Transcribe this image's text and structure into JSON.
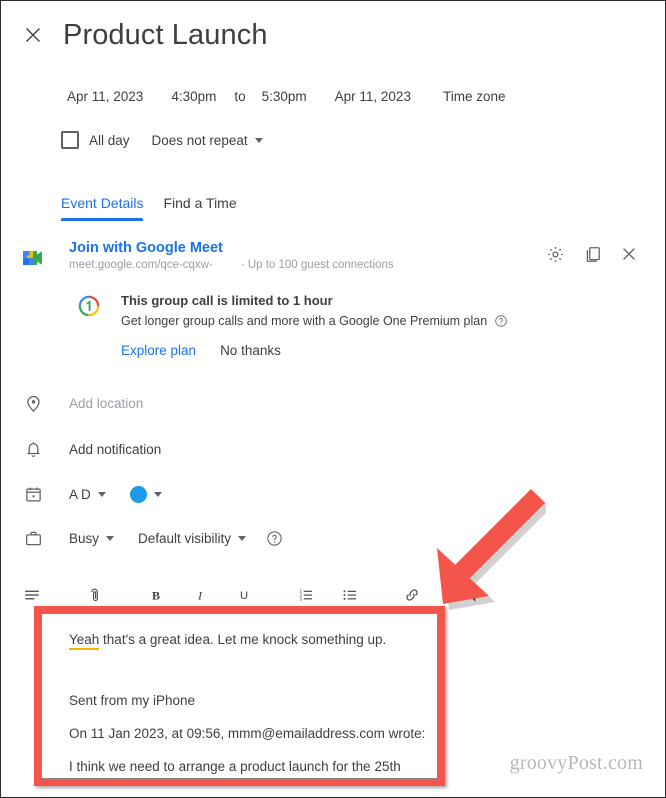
{
  "window": {
    "close_icon": "close-icon",
    "title": "Product Launch"
  },
  "schedule": {
    "start_date": "Apr 11, 2023",
    "start_time": "4:30pm",
    "to_label": "to",
    "end_time": "5:30pm",
    "end_date": "Apr 11, 2023",
    "timezone_label": "Time zone",
    "all_day_label": "All day",
    "repeat_label": "Does not repeat"
  },
  "tabs": [
    {
      "label": "Event Details",
      "active": true
    },
    {
      "label": "Find a Time",
      "active": false
    }
  ],
  "meet": {
    "icon": "google-meet-icon",
    "join_label": "Join with Google Meet",
    "url": "meet.google.com/qce-cqxw-",
    "guest_limit": "· Up to 100 guest connections",
    "settings_icon": "gear-icon",
    "copy_icon": "copy-icon",
    "remove_icon": "close-icon"
  },
  "google_one": {
    "badge_icon": "google-one-icon",
    "title": "This group call is limited to 1 hour",
    "description": "Get longer group calls and more with a Google One Premium plan",
    "help_icon": "help-circle-icon",
    "explore_label": "Explore plan",
    "decline_label": "No thanks"
  },
  "fields": {
    "location": {
      "icon": "location-pin-icon",
      "placeholder": "Add location"
    },
    "notification": {
      "icon": "bell-icon",
      "placeholder": "Add notification"
    },
    "calendar": {
      "icon": "calendar-icon",
      "owner": "A D",
      "color_icon": "color-dot-icon",
      "color": "#1a9ae8"
    },
    "availability": {
      "icon": "briefcase-icon",
      "busy_label": "Busy",
      "visibility_label": "Default visibility",
      "help_icon": "help-circle-icon"
    }
  },
  "format_toolbar": [
    {
      "name": "format-options-icon",
      "label": "≡"
    },
    {
      "name": "attachment-icon",
      "label": "attach"
    },
    {
      "name": "bold-icon",
      "label": "B"
    },
    {
      "name": "italic-icon",
      "label": "I"
    },
    {
      "name": "underline-icon",
      "label": "U"
    },
    {
      "name": "numbered-list-icon",
      "label": "numbered list"
    },
    {
      "name": "bulleted-list-icon",
      "label": "bulleted list"
    },
    {
      "name": "insert-link-icon",
      "label": "link"
    },
    {
      "name": "remove-formatting-icon",
      "label": "remove formatting"
    }
  ],
  "description_body": {
    "line1_misspelled": "Yeah",
    "line1_rest": " that's a great idea. Let me knock something up.",
    "line2": "Sent from my iPhone",
    "line3": "On 11 Jan 2023, at 09:56, mmm@emailaddress.com wrote:",
    "line4": "I think we need to arrange a product launch for the 25th"
  },
  "annotations": {
    "highlight_box_name": "description-highlight-box",
    "arrow_name": "red-pointer-arrow",
    "accent_color": "#f4554a"
  },
  "watermark": "groovyPost.com"
}
